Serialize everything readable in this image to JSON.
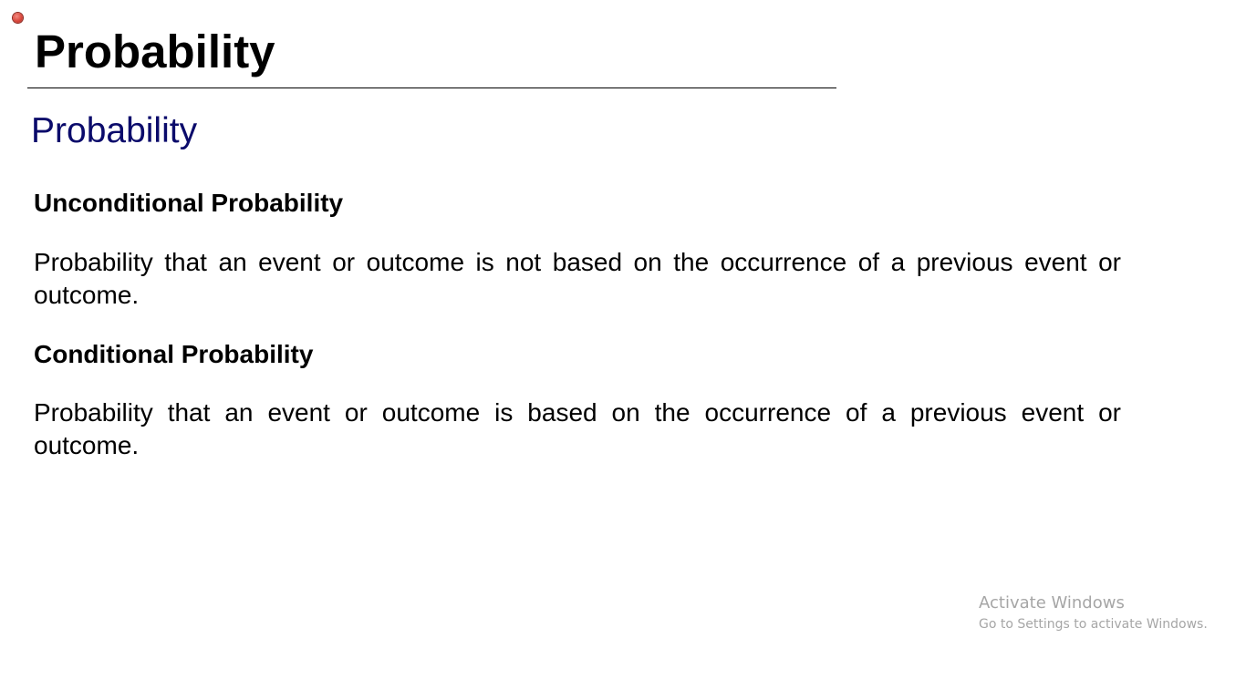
{
  "slide": {
    "title": "Probability",
    "section_heading": "Probability",
    "accent_color": "#0b0b6b",
    "items": [
      {
        "heading": "Unconditional Probability",
        "definition": "Probability that an event or outcome is not based on the occurrence of a previous event or outcome."
      },
      {
        "heading": "Conditional Probability",
        "definition": "Probability that an event or outcome is based on the occurrence of a previous event or outcome."
      }
    ]
  },
  "indicators": {
    "recording_icon": "record-dot-icon",
    "recording_color": "#d9473c"
  },
  "watermark": {
    "title": "Activate Windows",
    "subtitle": "Go to Settings to activate Windows."
  }
}
